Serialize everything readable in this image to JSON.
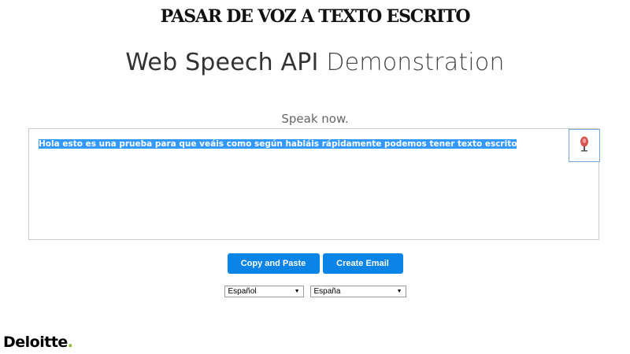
{
  "banner": {
    "text": "PASAR DE VOZ A TEXTO ESCRITO"
  },
  "title": {
    "main": "Web Speech API",
    "light": "Demonstration"
  },
  "status": {
    "text": "Speak now."
  },
  "results": {
    "transcript": "Hola esto es una prueba para que veáis como según habláis rápidamente podemos tener texto escrito",
    "highlight_color": "#3399ff"
  },
  "mic": {
    "icon": "microphone-icon",
    "accent": "#d9534f"
  },
  "buttons": {
    "copy_label": "Copy and Paste",
    "email_label": "Create Email",
    "color": "#0a84e6"
  },
  "selects": {
    "language_value": "Español",
    "dialect_value": "España"
  },
  "logo": {
    "name": "Deloitte",
    "dot": ".",
    "dot_color": "#86bc25"
  }
}
